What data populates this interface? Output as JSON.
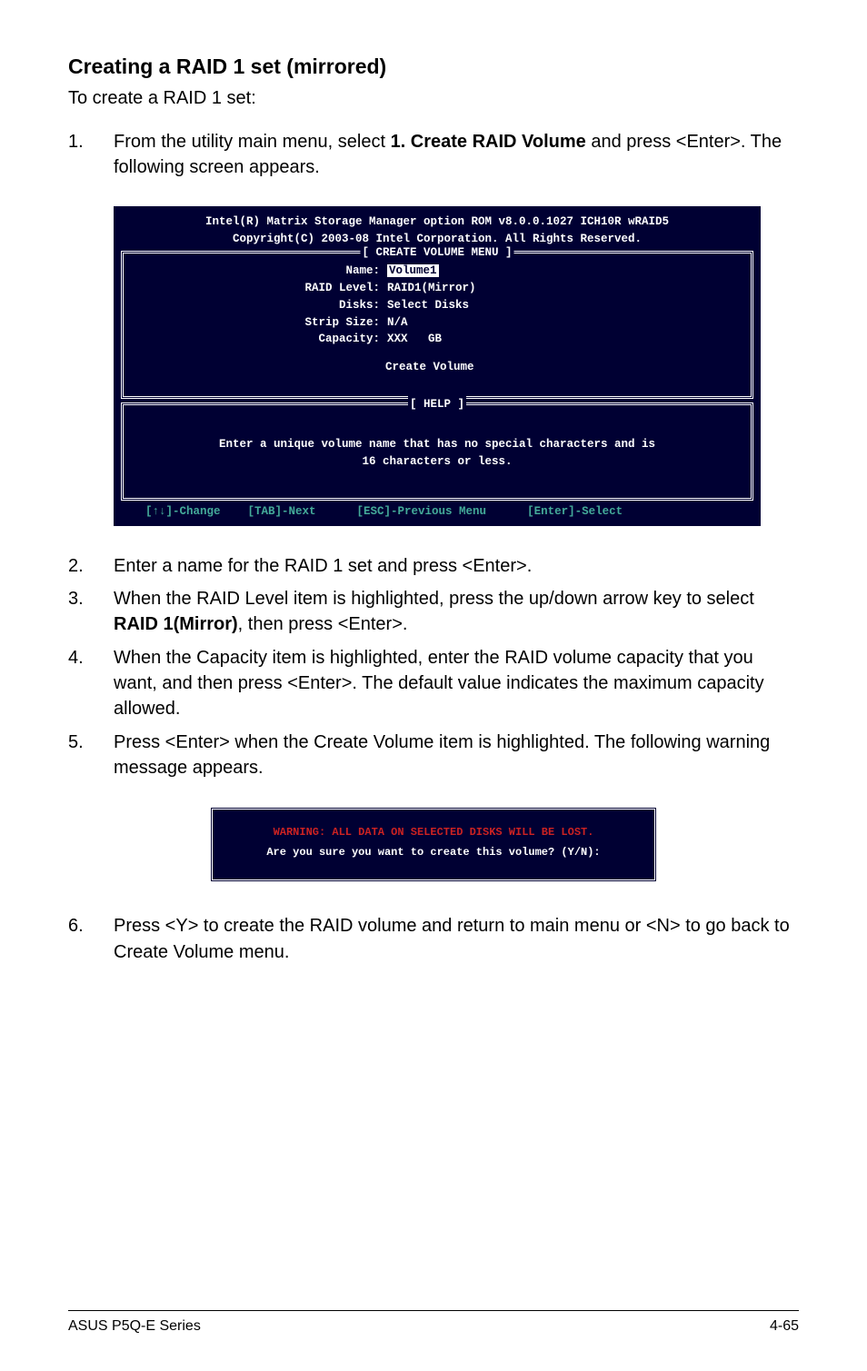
{
  "heading": "Creating a RAID 1 set (mirrored)",
  "intro": "To create a RAID 1 set:",
  "step1": {
    "num": "1.",
    "text_a": "From the utility main menu, select ",
    "bold": "1. Create RAID Volume",
    "text_b": " and press <Enter>. The following screen appears."
  },
  "bios": {
    "title1": "Intel(R) Matrix Storage Manager option ROM v8.0.0.1027 ICH10R wRAID5",
    "title2": "Copyright(C) 2003-08 Intel Corporation. All Rights Reserved.",
    "create_box_label": "[ CREATE VOLUME MENU ]",
    "fields": {
      "name_label": "Name:",
      "name_value": "Volume1",
      "raid_label": "RAID Level:",
      "raid_value": "RAID1(Mirror)",
      "disks_label": "Disks:",
      "disks_value": "Select Disks",
      "strip_label": "Strip Size:",
      "strip_value": "N/A",
      "capacity_label": "Capacity:",
      "capacity_value": "XXX   GB"
    },
    "create_volume": "Create Volume",
    "help_box_label": "[ HELP ]",
    "help_line1": "Enter a unique volume name that has no special characters and is",
    "help_line2": "16 characters or less.",
    "footer": "  [↑↓]-Change    [TAB]-Next      [ESC]-Previous Menu      [Enter]-Select"
  },
  "step2": {
    "num": "2.",
    "text": "Enter a name for the RAID 1 set and press <Enter>."
  },
  "step3": {
    "num": "3.",
    "text_a": "When the RAID Level item is highlighted, press the up/down arrow key to select ",
    "bold": "RAID 1(Mirror)",
    "text_b": ", then press <Enter>."
  },
  "step4": {
    "num": "4.",
    "text": "When the Capacity item is highlighted, enter the RAID volume capacity that you want, and then press <Enter>. The default value indicates the maximum capacity allowed."
  },
  "step5": {
    "num": "5.",
    "text": "Press <Enter> when the Create Volume item is highlighted. The following warning message appears."
  },
  "warning": {
    "line1": "WARNING: ALL DATA ON SELECTED DISKS WILL BE LOST.",
    "line2": "Are you sure you want to create this volume? (Y/N):"
  },
  "step6": {
    "num": "6.",
    "text": "Press <Y> to create the RAID volume and return to main menu or <N> to go back to Create Volume menu."
  },
  "footer": {
    "left": "ASUS P5Q-E Series",
    "right": "4-65"
  }
}
